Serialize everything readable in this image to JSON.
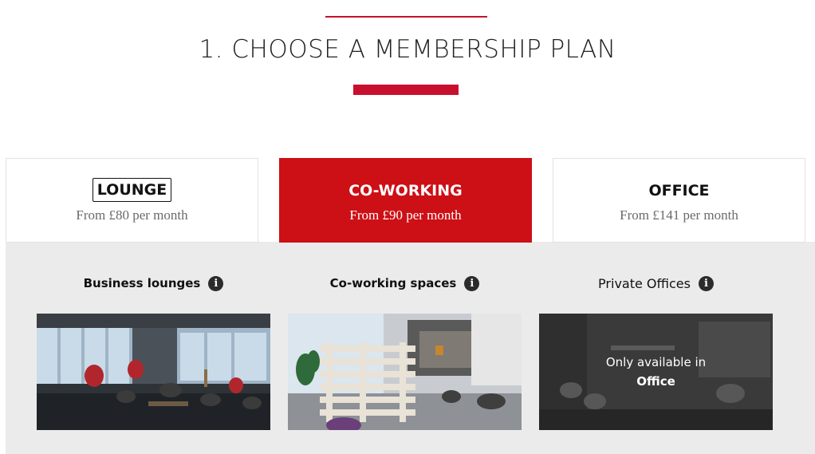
{
  "header": {
    "title": "1. CHOOSE A MEMBERSHIP PLAN"
  },
  "plans": [
    {
      "name": "LOUNGE",
      "price": "From £80 per month"
    },
    {
      "name": "CO-WORKING",
      "price": "From £90 per month",
      "selected": true
    },
    {
      "name": "OFFICE",
      "price": "From £141 per month"
    }
  ],
  "features": [
    {
      "label": "Business lounges",
      "info_icon": "info-icon"
    },
    {
      "label": "Co-working spaces",
      "info_icon": "info-icon"
    },
    {
      "label": "Private Offices",
      "info_icon": "info-icon",
      "note_line1": "Only available in",
      "note_line2": "Office"
    }
  ],
  "colors": {
    "accent": "#cc1016",
    "panel": "#ebebeb",
    "info_icon": "#2b2b2b"
  }
}
